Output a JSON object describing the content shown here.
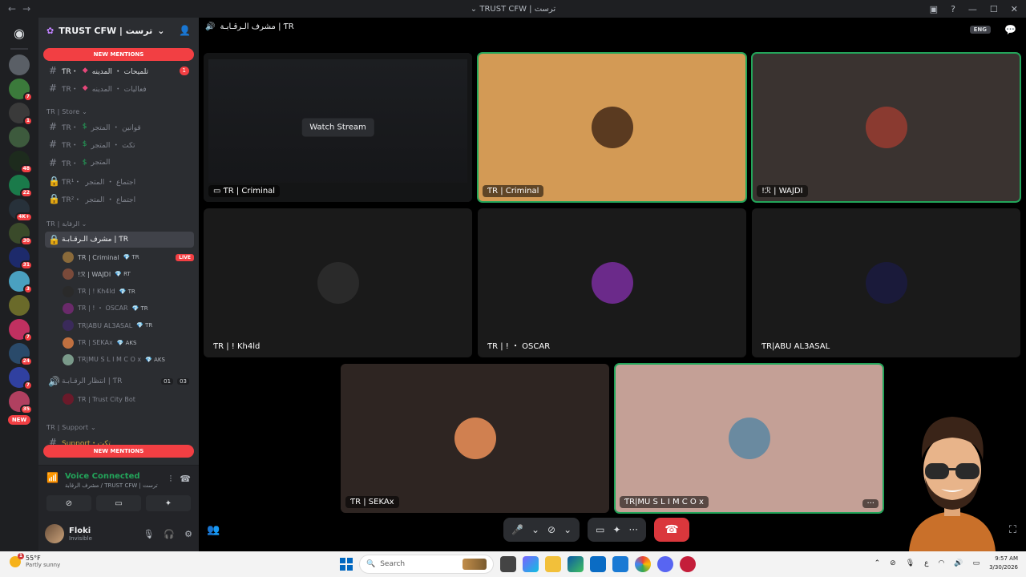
{
  "window": {
    "title": "TRUST CFW | ترست"
  },
  "rail": {
    "servers": [
      {
        "color": "#5a5f66",
        "badge": ""
      },
      {
        "color": "#3b7a3b",
        "badge": "7"
      },
      {
        "color": "#3a3a3a",
        "badge": "1"
      },
      {
        "color": "#3d5a3d",
        "badge": ""
      },
      {
        "color": "#1d2b1d",
        "badge": "48"
      },
      {
        "color": "#1a7a4a",
        "badge": "22"
      },
      {
        "color": "#27313a",
        "badge": "4K+"
      },
      {
        "color": "#3a4a2a",
        "badge": "30"
      },
      {
        "color": "#1d2a6b",
        "badge": "31"
      },
      {
        "color": "#4aa0c0",
        "badge": "3"
      },
      {
        "color": "#6a6a2a",
        "badge": ""
      },
      {
        "color": "#c03060",
        "badge": "7"
      },
      {
        "color": "#2a4a6a",
        "badge": "24"
      },
      {
        "color": "#3040a0",
        "badge": "7"
      },
      {
        "color": "#b04060",
        "badge": "35"
      }
    ],
    "new_label": "NEW"
  },
  "sidebar": {
    "server_name": "TRUST CFW | ترست",
    "new_mentions": "NEW MENTIONS",
    "channels_top": [
      {
        "prefix": "ƬR・",
        "name": "تلميحات ・ المدينه",
        "badge": "1"
      },
      {
        "prefix": "ƬR・",
        "name": "فعاليات ・ المدينه"
      }
    ],
    "store_category": "ƬR | Store",
    "store_channels": [
      {
        "prefix": "ƬR・",
        "name": "قوانين ・ المتجر"
      },
      {
        "prefix": "ƬR・",
        "name": "تكت ・ المتجر"
      },
      {
        "prefix": "ƬR・",
        "name": "المتجر"
      },
      {
        "prefix": "ƬR¹・",
        "name": "اجتماع ・ المتجر"
      },
      {
        "prefix": "ƬR²・",
        "name": "اجتماع ・ المتجر"
      }
    ],
    "voice_category": "ƬR | الرقابة",
    "voice_channel": "مشرف الـرقـابـة | ƬR",
    "voice_users": [
      {
        "name": "ƬR | Criminal",
        "tag": "ƬR",
        "live": "LIVE",
        "color": "#8a6a3a"
      },
      {
        "name": "!ℛ | WAJDI",
        "tag": "RT",
        "live": "",
        "color": "#7a4a3a"
      },
      {
        "name": "ƬR | ! Kh4ld",
        "tag": "ƬR",
        "live": "",
        "color": "#2a2a2a"
      },
      {
        "name": "ƬR | ! ・ OSCAR",
        "tag": "ƬR",
        "live": "",
        "color": "#6a2a6a"
      },
      {
        "name": "ƬR|ABU AL3ASAL",
        "tag": "ƬR",
        "live": "",
        "color": "#3a2a5a"
      },
      {
        "name": "ƬR | SEKAx",
        "tag": "AKS",
        "live": "",
        "color": "#c07040"
      },
      {
        "name": "ƬR|MU S L I M C O x",
        "tag": "AKS",
        "live": "",
        "color": "#7a9a8a"
      }
    ],
    "waiting_channel": "انتظار الرقـابـة | ƬR",
    "waiting_count_a": "01",
    "waiting_count_b": "03",
    "bot_user": "ƬR | Trust City Bot",
    "support_category": "ƬR | Support",
    "support_channel": "Support・تكت",
    "voice_panel": {
      "status": "Voice Connected",
      "location": "مشرف الرقابة / TRUST CFW | ترست"
    },
    "user": {
      "name": "Floki",
      "status": "Invisible"
    }
  },
  "main": {
    "channel_title": "مشرف الـرقـابـة | ƬR",
    "lang_pill": "ENG",
    "watch_stream": "Watch Stream",
    "tiles": [
      {
        "name": "ƬR | Criminal",
        "kind": "stream"
      },
      {
        "name": "ƬR | Criminal",
        "kind": "cam",
        "bg": "#d39a55",
        "speaking": true,
        "avatar": "#5a3a20"
      },
      {
        "name": "!ℛ | WAJDI",
        "kind": "cam",
        "bg": "#3a3330",
        "speaking": true,
        "avatar": "#8a3a30"
      },
      {
        "name": "ƬR | ! Kh4ld",
        "kind": "cam",
        "bg": "#1a1a1a",
        "avatar": "#2a2a2a"
      },
      {
        "name": "ƬR | ! ・ OSCAR",
        "kind": "cam",
        "bg": "#1a1a1a",
        "avatar": "#6b2a8a"
      },
      {
        "name": "ƬR|ABU AL3ASAL",
        "kind": "cam",
        "bg": "#1a1a1a",
        "avatar": "#1a1a3a"
      },
      {
        "name": "ƬR | SEKAx",
        "kind": "cam",
        "bg": "#2e2522",
        "avatar": "#d08050"
      },
      {
        "name": "ƬR|MU S L I M C O x",
        "kind": "cam",
        "bg": "#c4a096",
        "speaking": true,
        "avatar": "#6a8aa0"
      }
    ],
    "more_label": "···"
  },
  "taskbar": {
    "weather_temp": "55°F",
    "weather_desc": "Partly sunny",
    "search_placeholder": "Search",
    "time": "9:57 AM",
    "date": "3/30/2026",
    "lang": "ع"
  }
}
